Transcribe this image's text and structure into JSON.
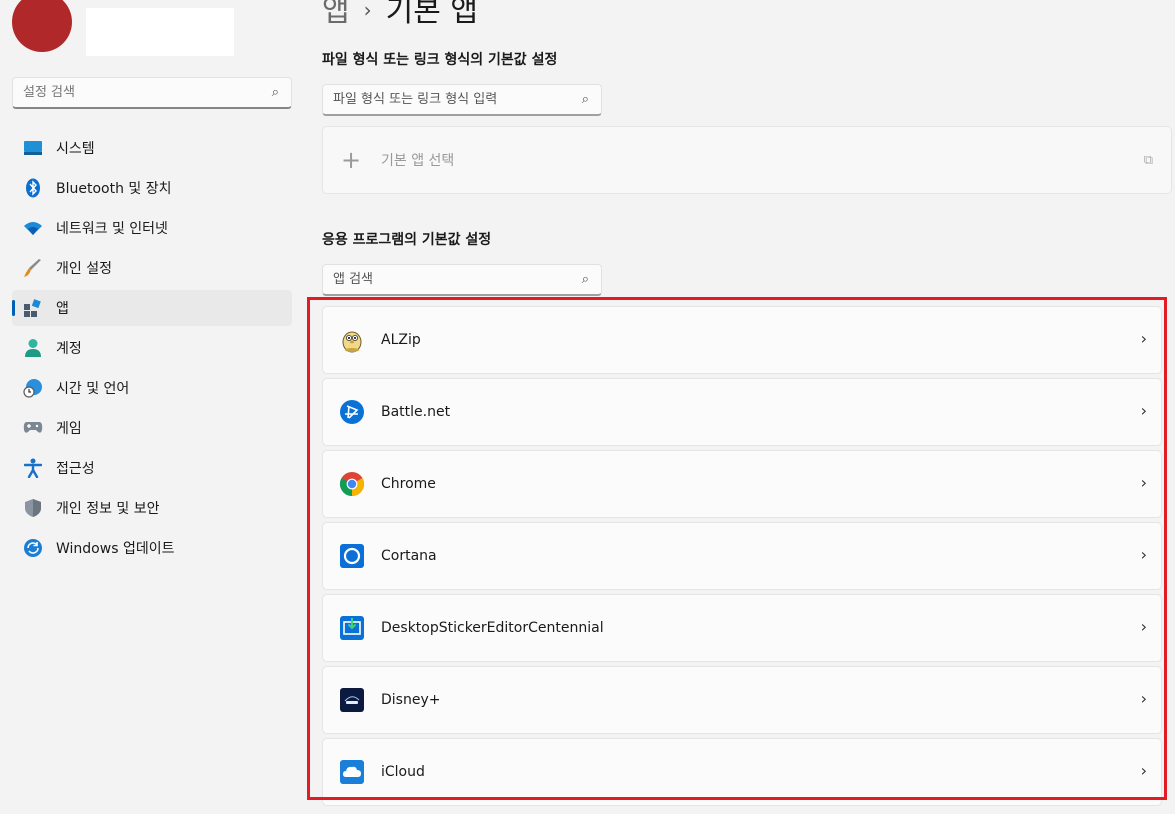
{
  "sidebar": {
    "search_placeholder": "설정 검색",
    "items": [
      {
        "label": "시스템",
        "icon": "system-icon"
      },
      {
        "label": "Bluetooth 및 장치",
        "icon": "bluetooth-icon"
      },
      {
        "label": "네트워크 및 인터넷",
        "icon": "wifi-icon"
      },
      {
        "label": "개인 설정",
        "icon": "brush-icon"
      },
      {
        "label": "앱",
        "icon": "apps-icon"
      },
      {
        "label": "계정",
        "icon": "account-icon"
      },
      {
        "label": "시간 및 언어",
        "icon": "globe-clock-icon"
      },
      {
        "label": "게임",
        "icon": "gamepad-icon"
      },
      {
        "label": "접근성",
        "icon": "accessibility-icon"
      },
      {
        "label": "개인 정보 및 보안",
        "icon": "shield-icon"
      },
      {
        "label": "Windows 업데이트",
        "icon": "update-icon"
      }
    ],
    "active_index": 4
  },
  "main": {
    "breadcrumb": {
      "parent": "앱",
      "separator": "›",
      "current": "기본 앱"
    },
    "file_section": {
      "title": "파일 형식 또는 링크 형식의 기본값 설정",
      "search_placeholder": "파일 형식 또는 링크 형식 입력",
      "choose_label": "기본 앱 선택"
    },
    "app_section": {
      "title": "응용 프로그램의 기본값 설정",
      "search_placeholder": "앱 검색"
    },
    "apps": [
      {
        "name": "ALZip",
        "icon": "alzip-icon"
      },
      {
        "name": "Battle.net",
        "icon": "battlenet-icon"
      },
      {
        "name": "Chrome",
        "icon": "chrome-icon"
      },
      {
        "name": "Cortana",
        "icon": "cortana-icon"
      },
      {
        "name": "DesktopStickerEditorCentennial",
        "icon": "sticker-editor-icon"
      },
      {
        "name": "Disney+",
        "icon": "disney-icon"
      },
      {
        "name": "iCloud",
        "icon": "icloud-icon"
      }
    ]
  },
  "colors": {
    "accent": "#005fb8",
    "highlight": "#e21b25",
    "avatar": "#b0282a"
  }
}
